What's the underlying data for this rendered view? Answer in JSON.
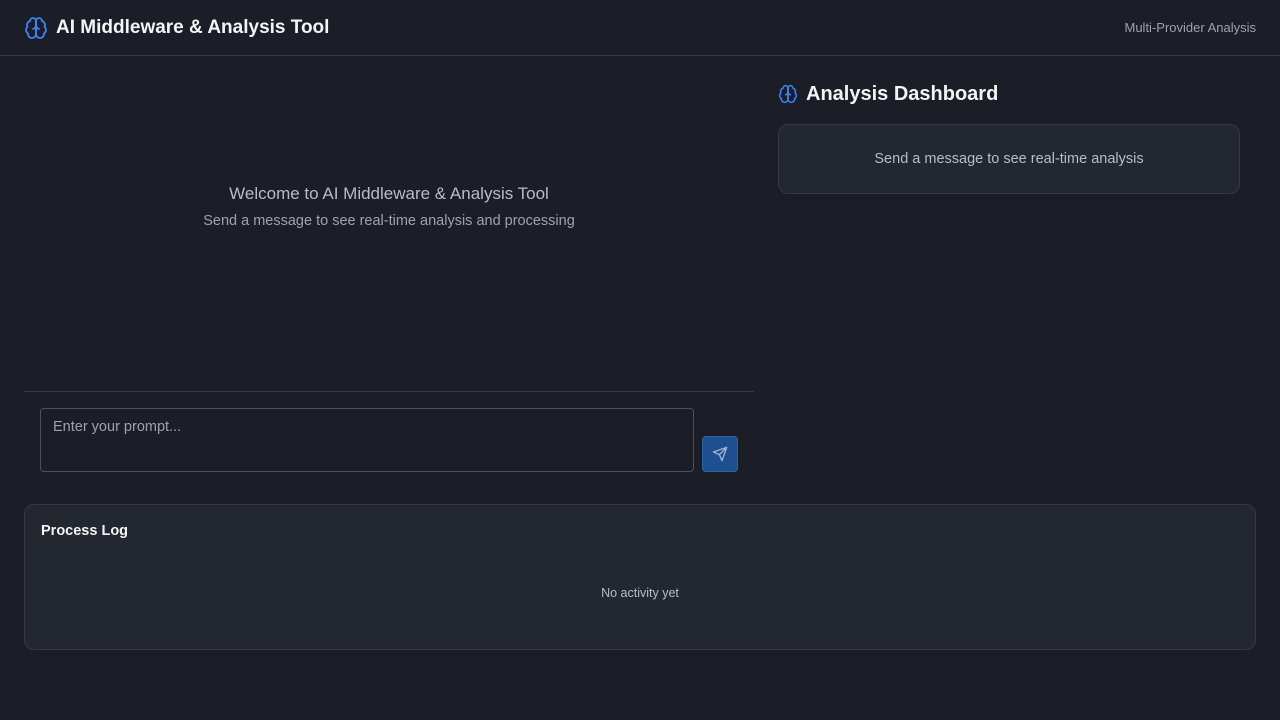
{
  "header": {
    "title": "AI Middleware & Analysis Tool",
    "subtitle": "Multi-Provider Analysis",
    "icon": "brain-icon",
    "accent_color": "#3b82f6"
  },
  "chat": {
    "welcome_title": "Welcome to AI Middleware & Analysis Tool",
    "welcome_subtitle": "Send a message to see real-time analysis and processing"
  },
  "composer": {
    "placeholder": "Enter your prompt...",
    "value": "",
    "send_icon": "send-icon",
    "send_color": "#1e4f8f"
  },
  "dashboard": {
    "title": "Analysis Dashboard",
    "icon": "brain-icon",
    "empty_text": "Send a message to see real-time analysis"
  },
  "process_log": {
    "title": "Process Log",
    "empty_text": "No activity yet"
  }
}
